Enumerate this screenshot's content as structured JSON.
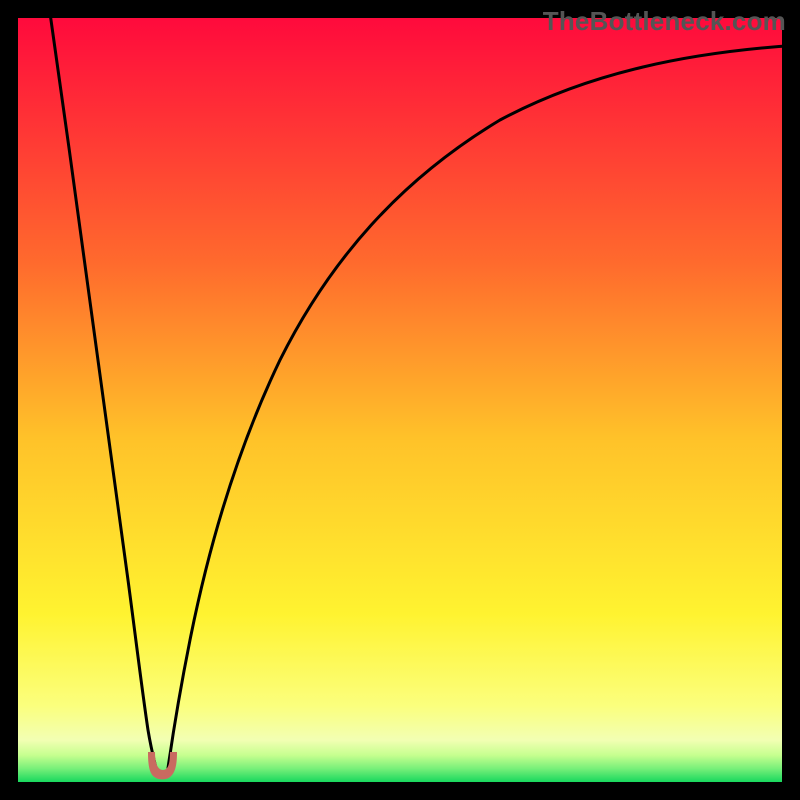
{
  "watermark": "TheBottleneck.com",
  "chart_data": {
    "type": "line",
    "title": "",
    "xlabel": "",
    "ylabel": "",
    "xlim": [
      0,
      100
    ],
    "ylim": [
      0,
      100
    ],
    "legend": false,
    "grid": false,
    "dip": {
      "x_percent": 19.2,
      "width_percent": 3.4
    },
    "series": [
      {
        "name": "left-arm",
        "x": [
          6.0,
          8.0,
          10.0,
          12.0,
          14.0,
          15.5,
          16.8,
          17.6,
          18.2,
          19.0
        ],
        "y": [
          100.0,
          88.0,
          76.0,
          63.0,
          49.0,
          36.0,
          24.0,
          14.0,
          7.5,
          3.0
        ]
      },
      {
        "name": "right-arm",
        "x": [
          19.8,
          20.6,
          21.6,
          23.0,
          25.0,
          28.0,
          32.0,
          38.0,
          46.0,
          55.0,
          66.0,
          78.0,
          90.0,
          100.0
        ],
        "y": [
          3.0,
          7.0,
          13.0,
          21.0,
          31.0,
          43.0,
          54.0,
          65.0,
          74.5,
          81.0,
          86.0,
          89.5,
          92.0,
          93.5
        ]
      },
      {
        "name": "valley-u",
        "x": [
          18.2,
          18.6,
          19.0,
          19.4,
          19.8,
          20.2,
          20.6
        ],
        "y": [
          4.5,
          2.2,
          1.2,
          1.0,
          1.2,
          2.2,
          4.5
        ]
      }
    ],
    "background_gradient": {
      "top_bottom_stops": [
        {
          "pos": 0.0,
          "color": "#ff0a3c"
        },
        {
          "pos": 0.32,
          "color": "#ff6a2d"
        },
        {
          "pos": 0.55,
          "color": "#ffc229"
        },
        {
          "pos": 0.78,
          "color": "#fff330"
        },
        {
          "pos": 0.9,
          "color": "#fbff7d"
        },
        {
          "pos": 0.945,
          "color": "#f2ffb3"
        },
        {
          "pos": 0.965,
          "color": "#c6ff8f"
        },
        {
          "pos": 0.982,
          "color": "#7af07a"
        },
        {
          "pos": 1.0,
          "color": "#18d85e"
        }
      ]
    }
  }
}
